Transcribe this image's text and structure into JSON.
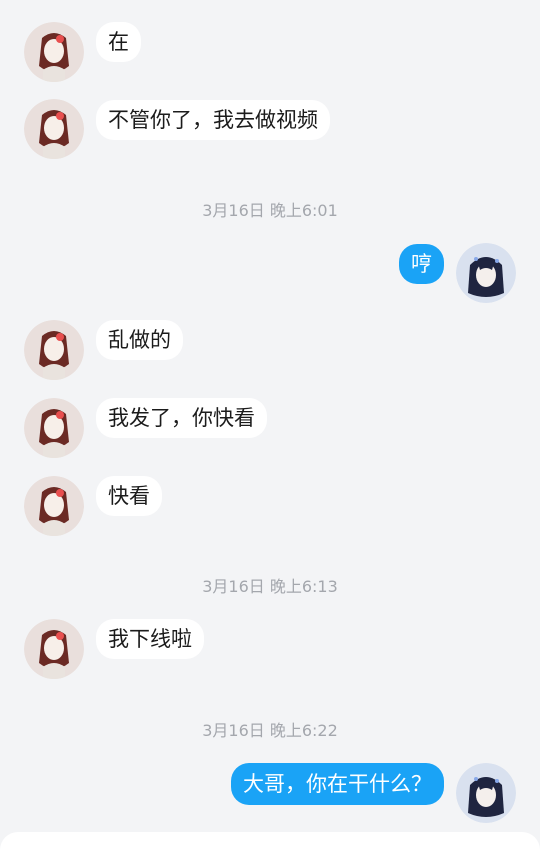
{
  "chat": {
    "messages": [
      {
        "side": "in",
        "text": "在"
      },
      {
        "side": "in",
        "text": "不管你了，我去做视频"
      },
      {
        "type": "time",
        "text": "3月16日 晚上6:01"
      },
      {
        "side": "out",
        "text": "哼"
      },
      {
        "side": "in",
        "text": "乱做的"
      },
      {
        "side": "in",
        "text": "我发了，你快看"
      },
      {
        "side": "in",
        "text": "快看"
      },
      {
        "type": "time",
        "text": "3月16日 晚上6:13"
      },
      {
        "side": "in",
        "text": "我下线啦"
      },
      {
        "type": "time",
        "text": "3月16日 晚上6:22"
      },
      {
        "side": "out",
        "text": "大哥，你在干什么？"
      }
    ]
  },
  "colors": {
    "background": "#f3f4f6",
    "incoming_bubble": "#ffffff",
    "outgoing_bubble": "#1aa3f6",
    "timestamp": "#a4a7ad"
  },
  "icons": {
    "incoming_avatar": "contact-avatar-icon",
    "outgoing_avatar": "self-avatar-icon"
  }
}
